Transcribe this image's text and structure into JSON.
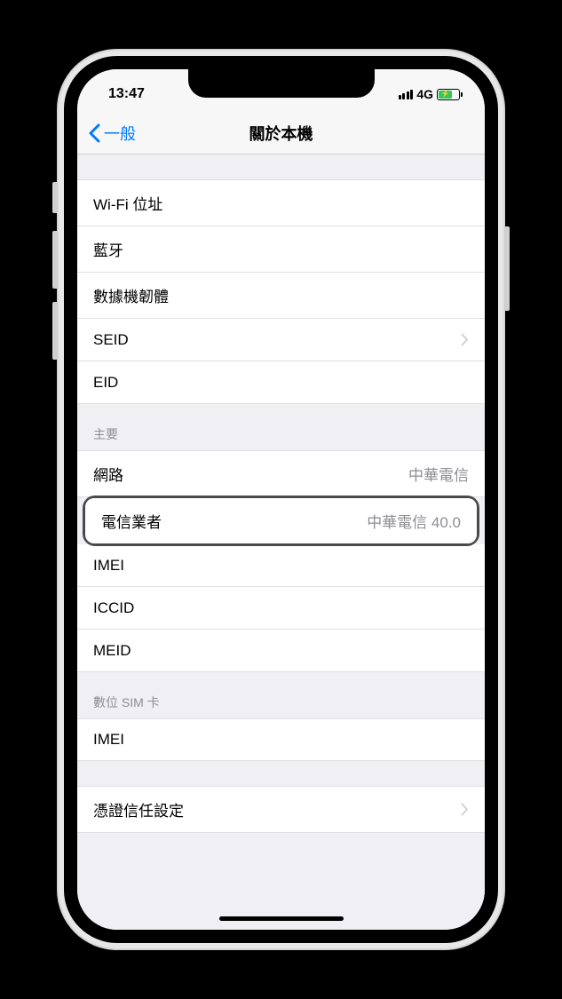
{
  "status": {
    "time": "13:47",
    "network": "4G"
  },
  "nav": {
    "back": "一般",
    "title": "關於本機"
  },
  "sections": {
    "first": {
      "rows": [
        {
          "label": "Wi-Fi 位址",
          "value": "",
          "chevron": false
        },
        {
          "label": "藍牙",
          "value": "",
          "chevron": false
        },
        {
          "label": "數據機韌體",
          "value": "",
          "chevron": false
        },
        {
          "label": "SEID",
          "value": "",
          "chevron": true
        },
        {
          "label": "EID",
          "value": "",
          "chevron": false
        }
      ]
    },
    "primary": {
      "header": "主要",
      "rows": [
        {
          "label": "網路",
          "value": "中華電信",
          "chevron": false
        },
        {
          "label": "電信業者",
          "value": "中華電信 40.0",
          "chevron": false,
          "highlighted": true
        },
        {
          "label": "IMEI",
          "value": "",
          "chevron": false
        },
        {
          "label": "ICCID",
          "value": "",
          "chevron": false
        },
        {
          "label": "MEID",
          "value": "",
          "chevron": false
        }
      ]
    },
    "esim": {
      "header": "數位 SIM 卡",
      "rows": [
        {
          "label": "IMEI",
          "value": "",
          "chevron": false
        }
      ]
    },
    "cert": {
      "rows": [
        {
          "label": "憑證信任設定",
          "value": "",
          "chevron": true
        }
      ]
    }
  }
}
